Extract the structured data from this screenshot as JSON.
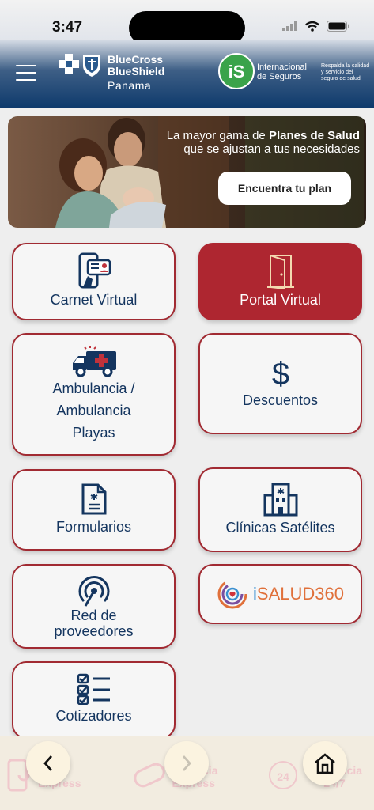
{
  "status_bar": {
    "time": "3:47"
  },
  "header": {
    "brand_name_line1": "BlueCross",
    "brand_name_line2": "BlueShield",
    "brand_region": "Panama",
    "partner_name_line1": "Internacional",
    "partner_name_line2": "de Seguros",
    "partner_logo_text": "iS",
    "partner_tagline_line1": "Respalda la calidad",
    "partner_tagline_line2": "y servicio del",
    "partner_tagline_line3": "seguro de salud"
  },
  "banner": {
    "text_pre": "La mayor gama de ",
    "text_bold": "Planes de Salud",
    "text_post": "que se ajustan a tus necesidades",
    "button_label": "Encuentra tu plan"
  },
  "menu": {
    "carnet": "Carnet Virtual",
    "portal": "Portal Virtual",
    "ambulancia_line1": "Ambulancia /",
    "ambulancia_line2": "Ambulancia",
    "ambulancia_line3": "Playas",
    "descuentos": "Descuentos",
    "formularios": "Formularios",
    "clinicas": "Clínicas Satélites",
    "isalud_i": "i",
    "isalud_rest": "SALUD360",
    "red_line1": "Red de",
    "red_line2": "proveedores",
    "cotizadores": "Cotizadores"
  },
  "bottom_nav": {
    "ghost1": "Express",
    "ghost2_line1": "Farmacia",
    "ghost2_line2": "Express",
    "ghost3_line1": "Asistencia",
    "ghost3_line2": "24/7",
    "badge_24": "24"
  },
  "colors": {
    "primary_navy": "#14355f",
    "accent_red": "#ae2630",
    "partner_green": "#3aa34a"
  }
}
